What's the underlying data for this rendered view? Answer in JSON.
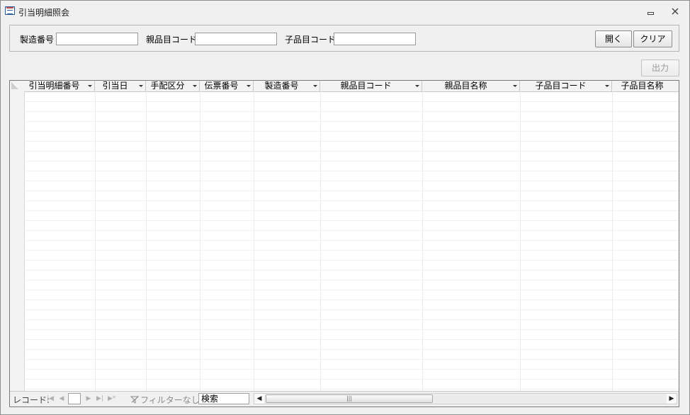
{
  "window": {
    "title": "引当明細照会",
    "minimize_icon": "minimize-icon",
    "close_label": "ꟷ"
  },
  "filters": {
    "seizo_bango_label": "製造番号",
    "seizo_bango_value": "",
    "oya_hinmoku_label": "親品目コード",
    "oya_hinmoku_value": "",
    "ko_hinmoku_label": "子品目コード",
    "ko_hinmoku_value": ""
  },
  "buttons": {
    "open": "開く",
    "clear": "クリア",
    "output": "出力"
  },
  "grid": {
    "columns": [
      {
        "label": "引当明細番号",
        "sortable": true
      },
      {
        "label": "引当日",
        "sortable": true
      },
      {
        "label": "手配区分",
        "sortable": true
      },
      {
        "label": "伝票番号",
        "sortable": true
      },
      {
        "label": "製造番号",
        "sortable": true
      },
      {
        "label": "親品目コード",
        "sortable": true
      },
      {
        "label": "親品目名称",
        "sortable": true
      },
      {
        "label": "子品目コード",
        "sortable": true
      },
      {
        "label": "子品目名称",
        "sortable": false
      }
    ],
    "rows": []
  },
  "navigation": {
    "record_label": "レコード:",
    "record_value": "",
    "filter_label": "フィルターなし",
    "search_label": "検索",
    "scroll_thumb_glyph": "|||"
  }
}
